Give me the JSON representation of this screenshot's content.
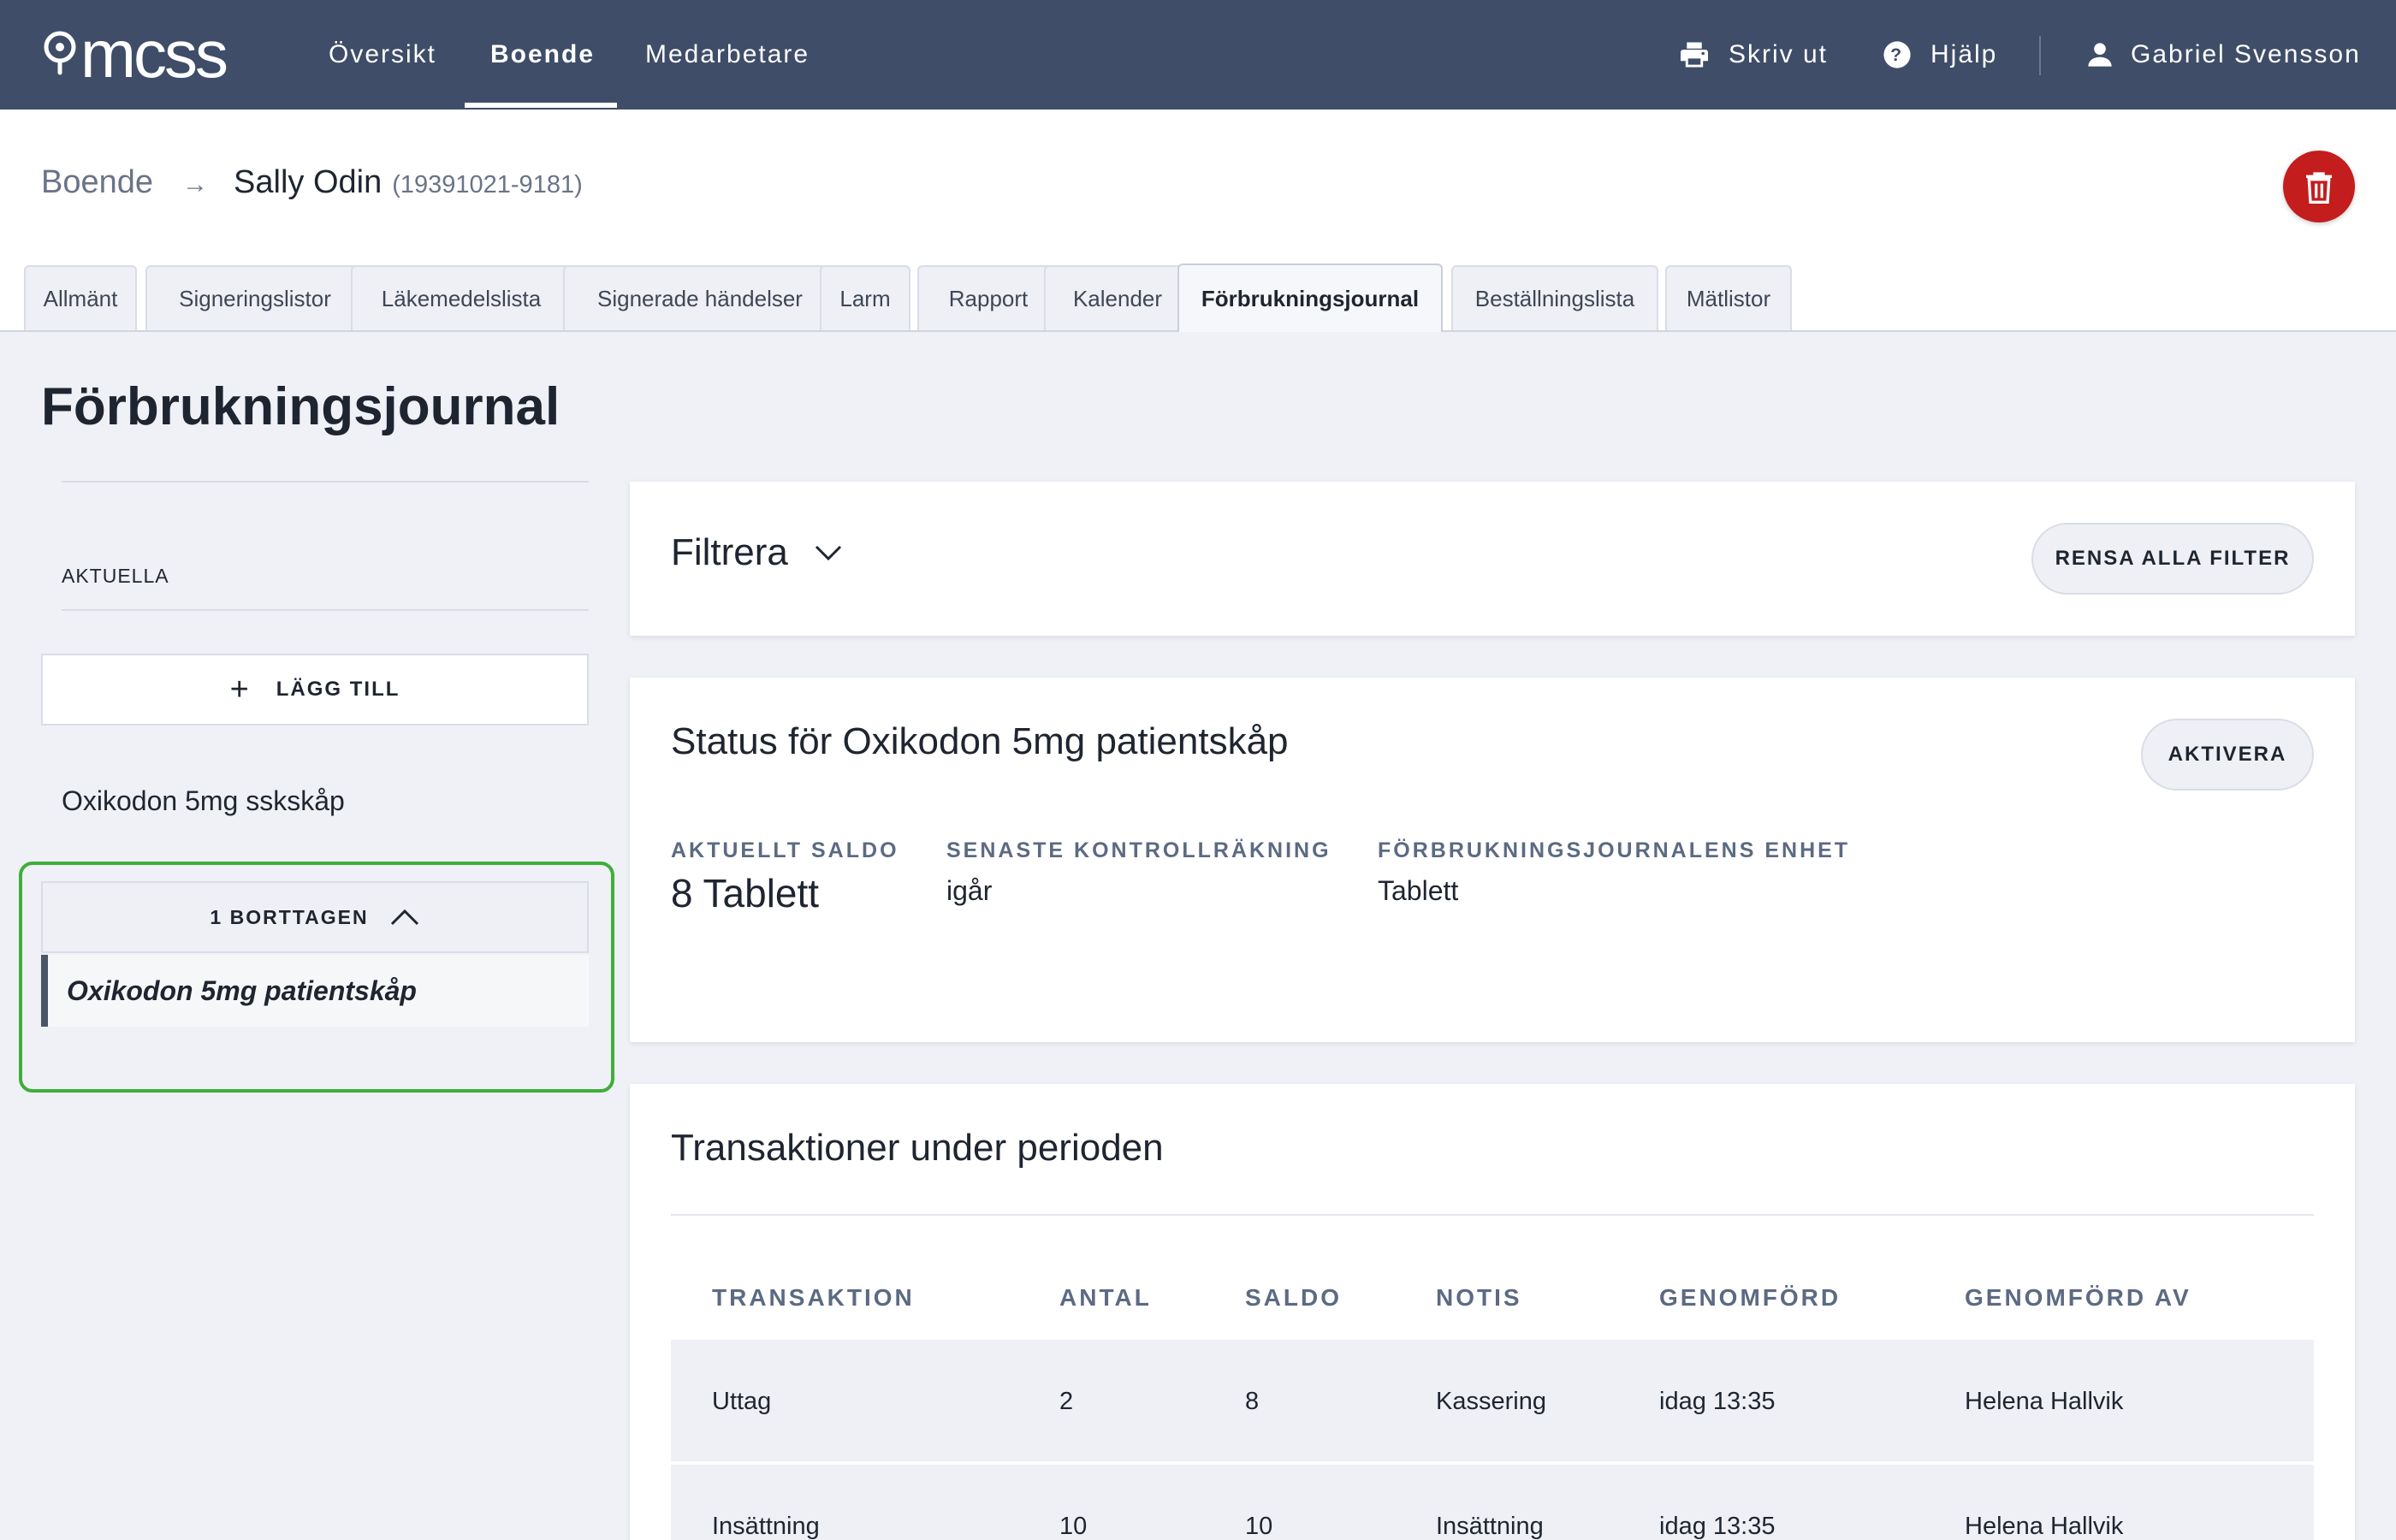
{
  "app": {
    "logo_text": "mcss"
  },
  "nav": {
    "items": [
      {
        "label": "Översikt",
        "active": false
      },
      {
        "label": "Boende",
        "active": true
      },
      {
        "label": "Medarbetare",
        "active": false
      }
    ],
    "print_label": "Skriv ut",
    "help_label": "Hjälp",
    "user_name": "Gabriel Svensson"
  },
  "breadcrumb": {
    "root": "Boende",
    "name": "Sally Odin",
    "id": "(19391021-9181)"
  },
  "tabs": [
    {
      "label": "Allmänt",
      "active": false
    },
    {
      "label": "Signeringslistor",
      "active": false
    },
    {
      "label": "Läkemedelslista",
      "active": false
    },
    {
      "label": "Signerade händelser",
      "active": false
    },
    {
      "label": "Larm",
      "active": false
    },
    {
      "label": "Rapport",
      "active": false
    },
    {
      "label": "Kalender",
      "active": false
    },
    {
      "label": "Förbrukningsjournal",
      "active": true
    },
    {
      "label": "Beställningslista",
      "active": false
    },
    {
      "label": "Mätlistor",
      "active": false
    }
  ],
  "page": {
    "title": "Förbrukningsjournal"
  },
  "sidebar": {
    "section_label": "AKTUELLA",
    "add_label": "LÄGG TILL",
    "items": [
      "Oxikodon 5mg sskskåp"
    ],
    "removed_label": "1 BORTTAGEN",
    "removed_items": [
      "Oxikodon 5mg patientskåp"
    ]
  },
  "filter": {
    "title": "Filtrera",
    "clear_label": "RENSA ALLA FILTER"
  },
  "status": {
    "title": "Status för Oxikodon 5mg patientskåp",
    "activate_label": "AKTIVERA",
    "balance_label": "AKTUELLT SALDO",
    "balance_value": "8 Tablett",
    "last_count_label": "SENASTE KONTROLLRÄKNING",
    "last_count_value": "igår",
    "unit_label": "FÖRBRUKNINGSJOURNALENS ENHET",
    "unit_value": "Tablett"
  },
  "transactions": {
    "title": "Transaktioner under perioden",
    "columns": [
      "TRANSAKTION",
      "ANTAL",
      "SALDO",
      "NOTIS",
      "GENOMFÖRD",
      "GENOMFÖRD AV"
    ],
    "rows": [
      [
        "Uttag",
        "2",
        "8",
        "Kassering",
        "idag 13:35",
        "Helena Hallvik"
      ],
      [
        "Insättning",
        "10",
        "10",
        "Insättning",
        "idag 13:35",
        "Helena Hallvik"
      ]
    ]
  },
  "colors": {
    "nav_bg": "#3f4d68",
    "danger": "#c41d1d",
    "highlight": "#3fae3a"
  }
}
